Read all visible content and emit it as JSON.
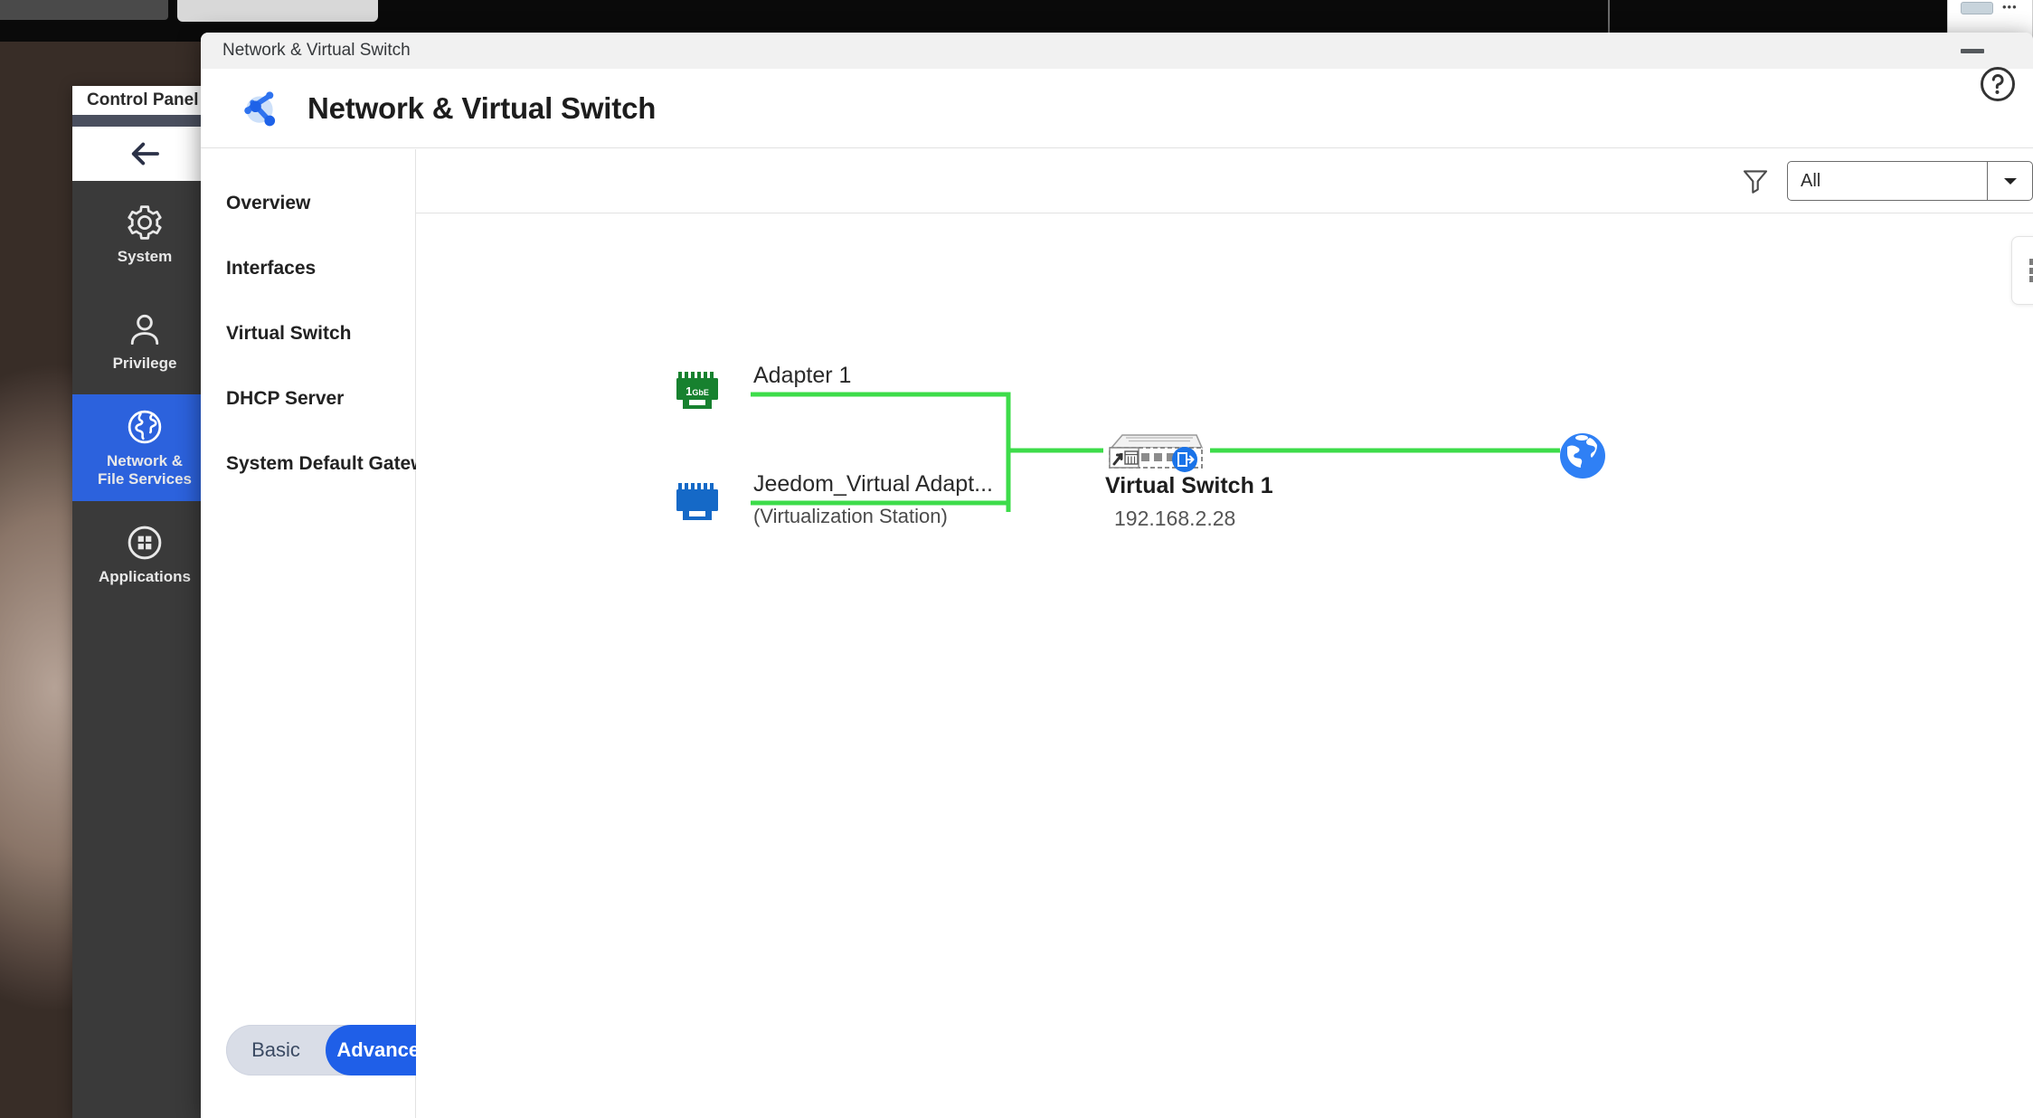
{
  "desktop": {
    "tab_placeholder": "",
    "mini_window": {
      "dots": "•••"
    }
  },
  "control_panel": {
    "title": "Control Panel",
    "back_icon": "back-arrow-icon",
    "items": [
      {
        "label": "System",
        "icon": "gear-icon",
        "active": false
      },
      {
        "label": "Privilege",
        "icon": "user-icon",
        "active": false
      },
      {
        "label": "Network &\nFile Services",
        "icon": "globe-icon",
        "active": true
      },
      {
        "label": "Applications",
        "icon": "grid-icon",
        "active": false
      }
    ]
  },
  "app": {
    "window_title": "Network & Virtual Switch",
    "header_title": "Network & Virtual Switch",
    "app_icon": "network-switch-icon",
    "help_icon": "help-circle-icon",
    "minimize_icon": "minimize-icon",
    "sidebar": {
      "items": [
        {
          "label": "Overview",
          "active": false
        },
        {
          "label": "Interfaces",
          "active": false
        },
        {
          "label": "Virtual Switch",
          "active": false
        },
        {
          "label": "DHCP Server",
          "active": false
        },
        {
          "label": "System Default Gateway",
          "active": false
        }
      ],
      "mode_toggle": {
        "basic_label": "Basic",
        "advanced_label": "Advanced",
        "selected": "Advanced"
      }
    },
    "toolbar": {
      "filter_icon": "funnel-icon",
      "filter_value": "All",
      "filter_options": [
        "All"
      ],
      "dropdown_icon": "chevron-down-icon",
      "kebab_icon": "more-options-icon"
    }
  },
  "topology": {
    "nodes": {
      "adapter1": {
        "label": "Adapter 1",
        "icon": "ethernet-port-icon",
        "speed_badge": "1GbE",
        "color": "#17812f",
        "status": "connected"
      },
      "adapter2": {
        "label": "Jeedom_Virtual Adapt...",
        "sublabel": "(Virtualization Station)",
        "icon": "ethernet-port-icon",
        "color": "#1569c7",
        "status": "connected"
      },
      "virtual_switch": {
        "label": "Virtual Switch 1",
        "ip": "192.168.2.28",
        "icon": "switch-device-icon",
        "badge_icon": "exit-gateway-icon"
      },
      "internet": {
        "label": "",
        "icon": "globe-icon",
        "color": "#1a73e8"
      }
    },
    "links": [
      {
        "from": "adapter1",
        "to": "virtual_switch",
        "color": "#3ddc4a"
      },
      {
        "from": "adapter2",
        "to": "virtual_switch",
        "color": "#3ddc4a"
      },
      {
        "from": "virtual_switch",
        "to": "internet",
        "color": "#3ddc4a"
      }
    ]
  },
  "colors": {
    "accent_blue": "#2c62dd",
    "link_green": "#3ddc4a",
    "adapter_green": "#17812f",
    "adapter_blue": "#1569c7"
  }
}
